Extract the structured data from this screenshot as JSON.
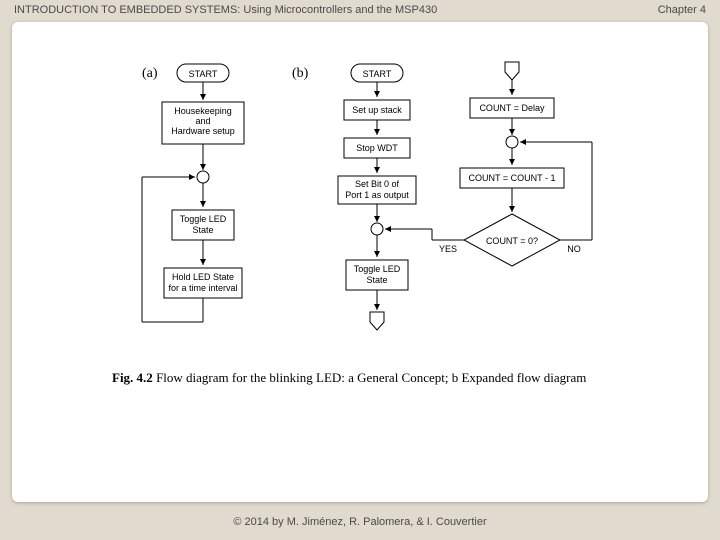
{
  "header": {
    "title": "INTRODUCTION TO EMBEDDED SYSTEMS: Using Microcontrollers and the MSP430",
    "chapter": "Chapter 4"
  },
  "footer": {
    "copyright": "© 2014 by M. Jiménez, R. Palomera, & I. Couvertier"
  },
  "diagram": {
    "label_a": "(a)",
    "label_b": "(b)",
    "a": {
      "start": "START",
      "housekeeping_l1": "Housekeeping",
      "housekeeping_l2": "and",
      "housekeeping_l3": "Hardware setup",
      "toggle_l1": "Toggle LED",
      "toggle_l2": "State",
      "hold_l1": "Hold LED State",
      "hold_l2": "for a time interval"
    },
    "b": {
      "start": "START",
      "setup_stack": "Set up stack",
      "stop_wdt": "Stop WDT",
      "setbit_l1": "Set Bit 0 of",
      "setbit_l2": "Port 1 as output",
      "toggle_l1": "Toggle LED",
      "toggle_l2": "State",
      "count_delay": "COUNT = Delay",
      "count_dec": "COUNT = COUNT - 1",
      "decision": "COUNT = 0?",
      "yes": "YES",
      "no": "NO"
    },
    "caption_prefix": "Fig. 4.2",
    "caption_body": "  Flow diagram for the blinking LED: a General Concept; b Expanded flow diagram"
  }
}
